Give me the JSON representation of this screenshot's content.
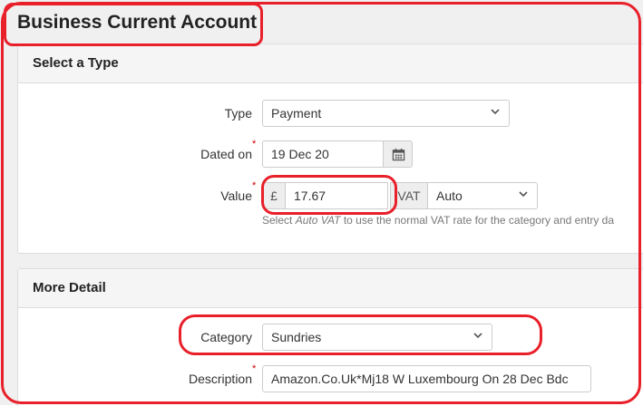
{
  "page": {
    "title": "Business Current Account"
  },
  "select_type": {
    "title": "Select a Type",
    "type": {
      "label": "Type",
      "value": "Payment",
      "icon": "chevron-down-icon"
    },
    "dated_on": {
      "label": "Dated on",
      "required": "*",
      "value": "19 Dec 20",
      "icon": "calendar-icon"
    },
    "value": {
      "label": "Value",
      "required": "*",
      "currency": "£",
      "amount": "17.67",
      "vat_label": "VAT",
      "vat_value": "Auto",
      "vat_icon": "chevron-down-icon",
      "help_prefix": "Select ",
      "help_em": "Auto VAT",
      "help_suffix": " to use the normal VAT rate for the category and entry da"
    }
  },
  "more_detail": {
    "title": "More Detail",
    "category": {
      "label": "Category",
      "value": "Sundries",
      "icon": "chevron-down-icon"
    },
    "description": {
      "label": "Description",
      "required": "*",
      "value": "Amazon.Co.Uk*Mj18 W Luxembourg On 28 Dec Bdc"
    }
  },
  "colors": {
    "annotation": "#e8202a",
    "required": "#cc0000",
    "panel_header": "#f5f5f5"
  }
}
